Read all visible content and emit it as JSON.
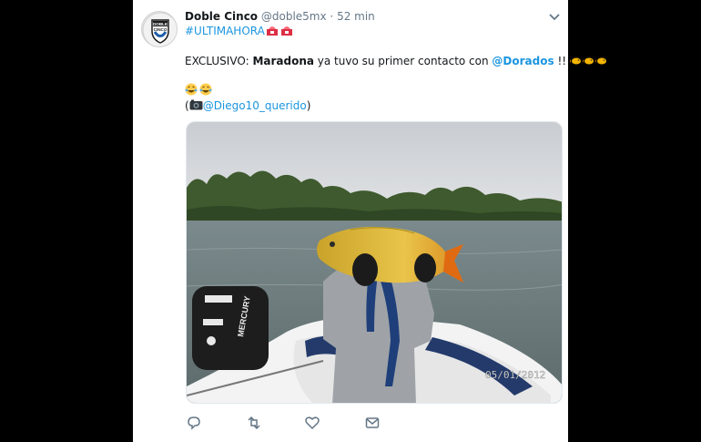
{
  "tweet": {
    "display_name": "Doble Cinco",
    "handle": "@doble5mx",
    "separator": "·",
    "time": "52 min",
    "avatar_text_top": "DOBLE",
    "avatar_text_bottom": "CINCO",
    "hashtag": "#ULTIMAHORA",
    "body_prefix": "EXCLUSIVO: ",
    "body_bold": "Maradona",
    "body_middle": " ya tuvo su primer contacto con ",
    "body_mention": "@Dorados",
    "body_suffix": " !!",
    "credit_open": "(",
    "credit_mention": "@Diego10_querido",
    "credit_close": ")",
    "photo_datestamp": "05/01/2012",
    "photo_motor_brand": "MERCURY"
  },
  "icons": [
    "siren-emoji-icon",
    "fish-emoji-icon",
    "laughing-emoji-icon",
    "camera-emoji-icon",
    "reply-icon",
    "retweet-icon",
    "like-icon",
    "message-icon",
    "chevron-down-icon"
  ],
  "colors": {
    "link": "#1b95e0",
    "text": "#14171a",
    "muted": "#657786",
    "background": "#000000"
  }
}
